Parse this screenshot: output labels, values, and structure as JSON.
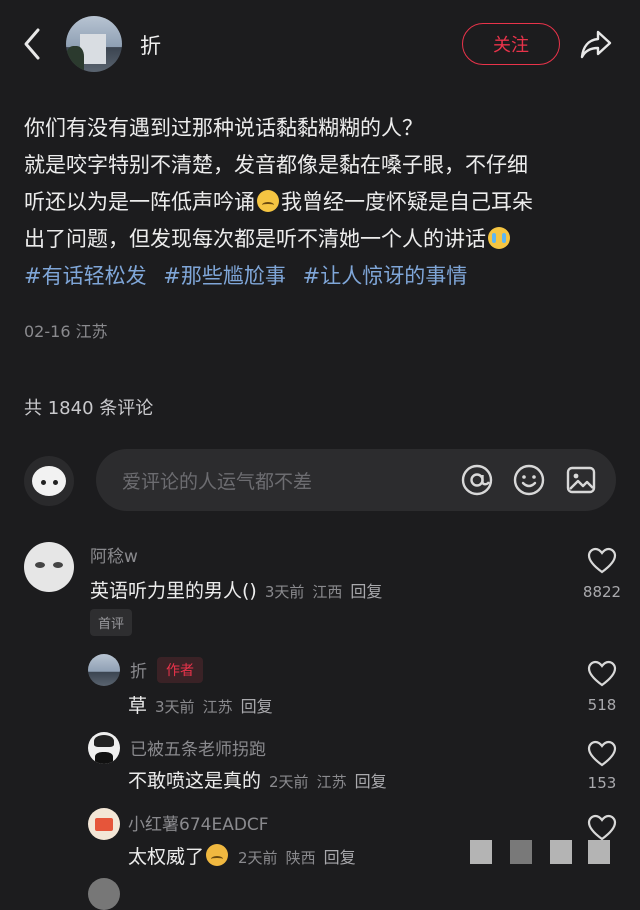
{
  "header": {
    "author_name": "折",
    "follow_label": "关注"
  },
  "post": {
    "line1": "你们有没有遇到过那种说话黏黏糊糊的人？",
    "line2": "就是咬字特别不清楚，发音都像是黏在嗓子眼，不仔细",
    "line3a": "听还以为是一阵低声吟诵",
    "line3b": "我曾经一度怀疑是自己耳朵",
    "line4": "出了问题，但发现每次都是听不清她一个人的讲话",
    "tags": [
      "#有话轻松发",
      "#那些尴尬事",
      "#让人惊讶的事情"
    ],
    "date": "02-16",
    "location": "江苏"
  },
  "comments_count_label": "共 1840 条评论",
  "input": {
    "placeholder": "爱评论的人运气都不差"
  },
  "comments": [
    {
      "user": "阿稔w",
      "text": "英语听力里的男人()",
      "time": "3天前",
      "location": "江西",
      "reply": "回复",
      "badge": "首评",
      "likes": "8822"
    }
  ],
  "replies": [
    {
      "user": "折",
      "badge": "作者",
      "text": "草",
      "time": "3天前",
      "location": "江苏",
      "reply": "回复",
      "likes": "518"
    },
    {
      "user": "已被五条老师拐跑",
      "text": "不敢喷这是真的",
      "time": "2天前",
      "location": "江苏",
      "reply": "回复",
      "likes": "153"
    },
    {
      "user": "小红薯674EADCF",
      "text": "太权威了",
      "time": "2天前",
      "location": "陕西",
      "reply": "回复",
      "likes": ""
    }
  ],
  "colors": {
    "background": "#1c1c1e",
    "accent": "#e8334a",
    "tag": "#7fa6d8"
  }
}
